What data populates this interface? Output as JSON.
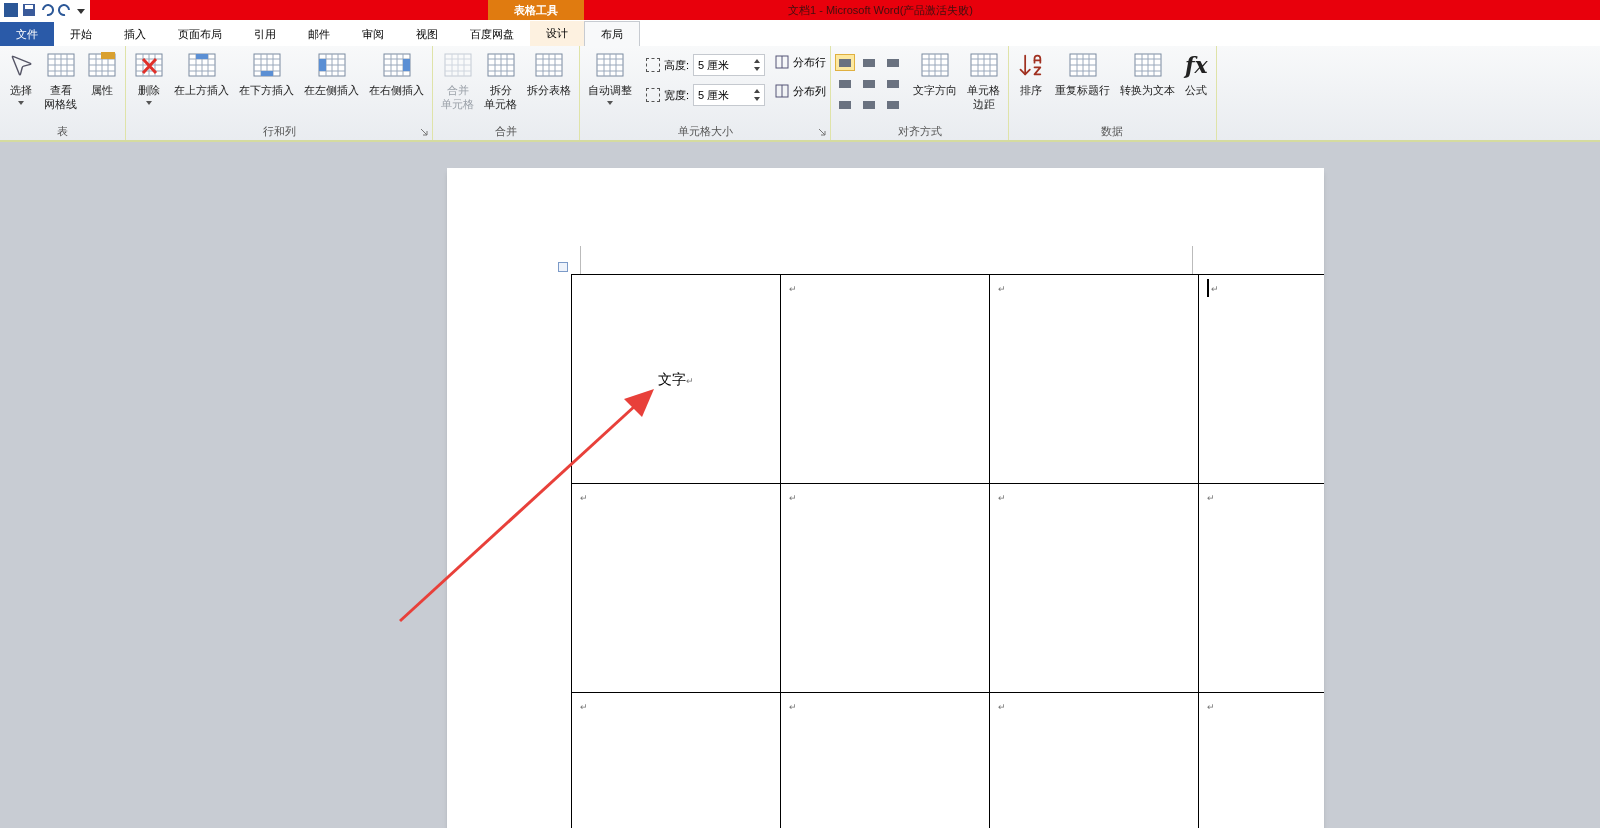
{
  "window": {
    "title": "文档1 - Microsoft Word(产品激活失败)",
    "context_label": "表格工具"
  },
  "tabs": [
    {
      "label": "文件",
      "kind": "file",
      "selected": false
    },
    {
      "label": "开始",
      "kind": "normal",
      "selected": false
    },
    {
      "label": "插入",
      "kind": "normal",
      "selected": false
    },
    {
      "label": "页面布局",
      "kind": "normal",
      "selected": false
    },
    {
      "label": "引用",
      "kind": "normal",
      "selected": false
    },
    {
      "label": "邮件",
      "kind": "normal",
      "selected": false
    },
    {
      "label": "审阅",
      "kind": "normal",
      "selected": false
    },
    {
      "label": "视图",
      "kind": "normal",
      "selected": false
    },
    {
      "label": "百度网盘",
      "kind": "normal",
      "selected": false
    },
    {
      "label": "设计",
      "kind": "context",
      "selected": false
    },
    {
      "label": "布局",
      "kind": "context",
      "selected": true
    }
  ],
  "ribbon": [
    {
      "label": "表",
      "items": [
        {
          "kind": "large",
          "label": "选择",
          "dropdown": true,
          "disabled": false
        },
        {
          "kind": "large",
          "label": [
            "查看",
            "网格线"
          ],
          "dropdown": false,
          "disabled": false
        },
        {
          "kind": "large",
          "label": "属性",
          "dropdown": false,
          "disabled": false
        }
      ]
    },
    {
      "label": "行和列",
      "launcher": true,
      "items": [
        {
          "kind": "large",
          "label": "删除",
          "dropdown": true,
          "disabled": false
        },
        {
          "kind": "large",
          "label": "在上方插入",
          "dropdown": false,
          "disabled": false
        },
        {
          "kind": "large",
          "label": "在下方插入",
          "dropdown": false,
          "disabled": false
        },
        {
          "kind": "large",
          "label": "在左侧插入",
          "dropdown": false,
          "disabled": false
        },
        {
          "kind": "large",
          "label": "在右侧插入",
          "dropdown": false,
          "disabled": false
        }
      ]
    },
    {
      "label": "合并",
      "items": [
        {
          "kind": "large",
          "label": [
            "合并",
            "单元格"
          ],
          "dropdown": false,
          "disabled": true
        },
        {
          "kind": "large",
          "label": [
            "拆分",
            "单元格"
          ],
          "dropdown": false,
          "disabled": false
        },
        {
          "kind": "large",
          "label": "拆分表格",
          "dropdown": false,
          "disabled": false
        }
      ]
    },
    {
      "label": "单元格大小",
      "launcher": true,
      "items": [
        {
          "kind": "large",
          "label": "自动调整",
          "dropdown": true,
          "disabled": false
        },
        {
          "kind": "fields",
          "fields": [
            {
              "label": "高度:",
              "value": "5 厘米"
            },
            {
              "label": "宽度:",
              "value": "5 厘米"
            }
          ]
        },
        {
          "kind": "smalls",
          "buttons": [
            "分布行",
            "分布列"
          ]
        }
      ]
    },
    {
      "label": "对齐方式",
      "items": [
        {
          "kind": "align",
          "options": [
            {
              "selected": true
            },
            {
              "selected": false
            },
            {
              "selected": false
            },
            {
              "selected": false
            },
            {
              "selected": false
            },
            {
              "selected": false
            },
            {
              "selected": false
            },
            {
              "selected": false
            },
            {
              "selected": false
            }
          ]
        },
        {
          "kind": "large",
          "label": "文字方向",
          "dropdown": false,
          "disabled": false
        },
        {
          "kind": "large",
          "label": [
            "单元格",
            "边距"
          ],
          "dropdown": false,
          "disabled": false
        }
      ]
    },
    {
      "label": "数据",
      "items": [
        {
          "kind": "large",
          "label": "排序",
          "dropdown": false,
          "disabled": false
        },
        {
          "kind": "large",
          "label": "重复标题行",
          "dropdown": false,
          "disabled": false
        },
        {
          "kind": "large",
          "label": "转换为文本",
          "dropdown": false,
          "disabled": false
        },
        {
          "kind": "large",
          "label": "公式",
          "glyph": "fx",
          "dropdown": false,
          "disabled": false
        }
      ]
    }
  ],
  "table": {
    "rows": [
      [
        {
          "text": "文字",
          "mark": "↵",
          "kind": "centered",
          "cursor": false
        },
        {
          "mark": "↵",
          "kind": "top",
          "cursor": false
        },
        {
          "mark": "↵",
          "kind": "top",
          "cursor": false
        },
        {
          "mark": "↵",
          "kind": "top",
          "cursor": true
        }
      ],
      [
        {
          "mark": "↵",
          "kind": "top",
          "cursor": false
        },
        {
          "mark": "↵",
          "kind": "top",
          "cursor": false
        },
        {
          "mark": "↵",
          "kind": "top",
          "cursor": false
        },
        {
          "mark": "↵",
          "kind": "top",
          "cursor": false
        }
      ],
      [
        {
          "mark": "↵",
          "kind": "top",
          "cursor": false
        },
        {
          "mark": "↵",
          "kind": "top",
          "cursor": false
        },
        {
          "mark": "↵",
          "kind": "top",
          "cursor": false
        },
        {
          "mark": "↵",
          "kind": "top",
          "cursor": false
        }
      ]
    ]
  }
}
